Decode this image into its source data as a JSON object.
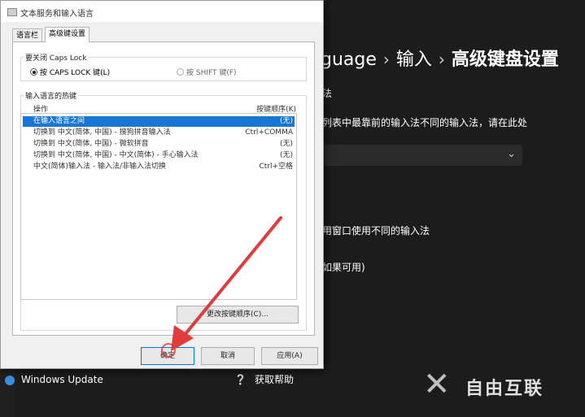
{
  "background": {
    "breadcrumb": [
      "guage",
      "输入",
      "高级键盘设置"
    ],
    "text_fa": "法",
    "text_list": "列表中最靠前的输入法不同的输入法，请在此处",
    "text_window": "用窗口使用不同的输入法",
    "text_avail": "如果可用)",
    "sidebar_windows_update": "Windows Update",
    "help_label": "获取帮助",
    "watermark": "自由互联"
  },
  "dialog": {
    "title": "文本服务和输入语言",
    "tabs": [
      "语言栏",
      "高级键设置"
    ],
    "caps_group_title": "要关闭 Caps Lock",
    "radio_caps": "按 CAPS LOCK 键(L)",
    "radio_shift": "按 SHIFT 键(F)",
    "hotkey_group_title": "输入语言的热键",
    "col_action": "操作",
    "col_keys": "按键顺序(K)",
    "rows": [
      {
        "action": "在输入语言之间",
        "keys": "(无)"
      },
      {
        "action": "切换到 中文(简体, 中国) - 搜狗拼音输入法",
        "keys": "Ctrl+COMMA"
      },
      {
        "action": "切换到 中文(简体, 中国) - 微软拼音",
        "keys": "(无)"
      },
      {
        "action": "切换到 中文(简体, 中国) - 中文(简体) - 手心输入法",
        "keys": "(无)"
      },
      {
        "action": "中文(简体)输入法 - 输入法/非输入法切换",
        "keys": "Ctrl+空格"
      }
    ],
    "change_button": "更改按键顺序(C)...",
    "ok_button": "确定",
    "cancel_button": "取消",
    "apply_button": "应用(A)"
  },
  "colors": {
    "selection": "#1777d2",
    "annotation": "#e23b3b"
  }
}
